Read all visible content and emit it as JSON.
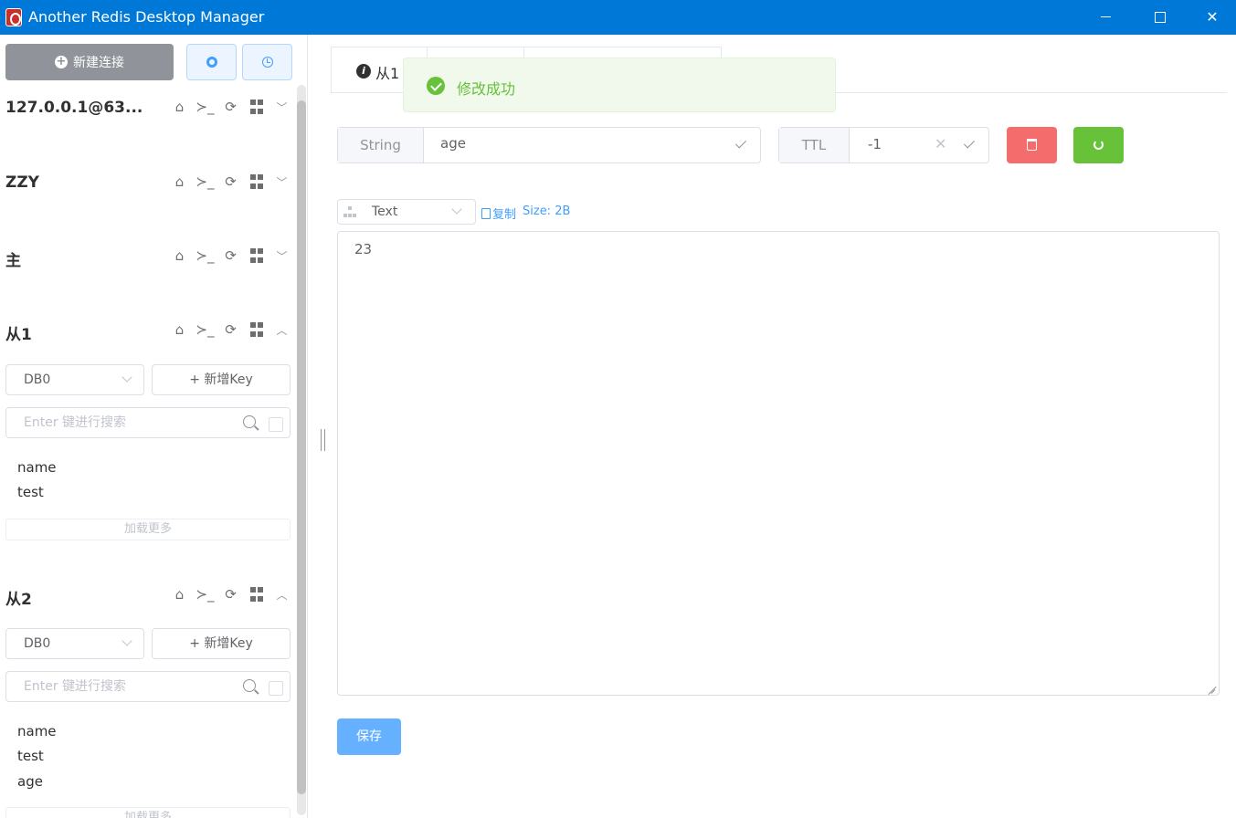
{
  "window": {
    "title": "Another Redis Desktop Manager",
    "close_glyph": "✕"
  },
  "sidebar": {
    "new_connection_label": "新建连接",
    "connections": [
      {
        "name": "127.0.0.1@63..."
      },
      {
        "name": "ZZY"
      },
      {
        "name": "主"
      },
      {
        "name": "从1",
        "db": "DB0",
        "add_key_label": "+ 新增Key",
        "search_placeholder": "Enter 键进行搜索",
        "keys": [
          "name",
          "test"
        ],
        "load_more_label": "加载更多"
      },
      {
        "name": "从2",
        "db": "DB0",
        "add_key_label": "+ 新增Key",
        "search_placeholder": "Enter 键进行搜索",
        "keys": [
          "name",
          "test",
          "age"
        ],
        "load_more_label": "加载更多"
      }
    ],
    "icon_names": [
      "home-icon",
      "terminal-icon",
      "refresh-icon",
      "grid-icon",
      "chevron-icon"
    ]
  },
  "main": {
    "active_tab_label": "从1",
    "toast_message": "修改成功",
    "key_type": "String",
    "key_name": "age",
    "ttl_label": "TTL",
    "ttl_value": "-1",
    "format": "Text",
    "copy_label": "复制",
    "size_label": "Size: 2B",
    "value": "23",
    "save_label": "保存"
  },
  "colors": {
    "titlebar": "#0078d7",
    "danger": "#f56c6c",
    "success": "#67c23a",
    "primary": "#409eff",
    "info": "#909399"
  }
}
